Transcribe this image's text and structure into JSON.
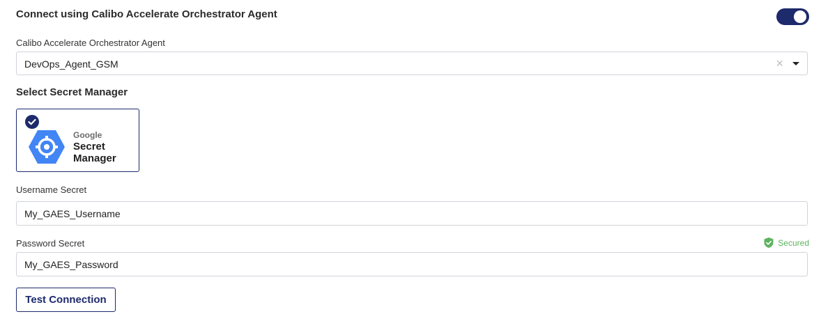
{
  "header": {
    "title": "Connect using Calibo Accelerate Orchestrator Agent",
    "toggle_on": true
  },
  "agent": {
    "label": "Calibo Accelerate Orchestrator Agent",
    "value": "DevOps_Agent_GSM"
  },
  "secret_manager": {
    "section_title": "Select Secret Manager",
    "option": {
      "brand": "Google",
      "name_line1": "Secret",
      "name_line2": "Manager",
      "selected": true
    }
  },
  "username": {
    "label": "Username Secret",
    "value": "My_GAES_Username"
  },
  "password": {
    "label": "Password Secret",
    "value": "My_GAES_Password",
    "status": "Secured"
  },
  "actions": {
    "test_connection": "Test Connection"
  },
  "colors": {
    "accent": "#1d2a6b",
    "secured": "#5fb35f",
    "google_blue": "#4285f4"
  }
}
